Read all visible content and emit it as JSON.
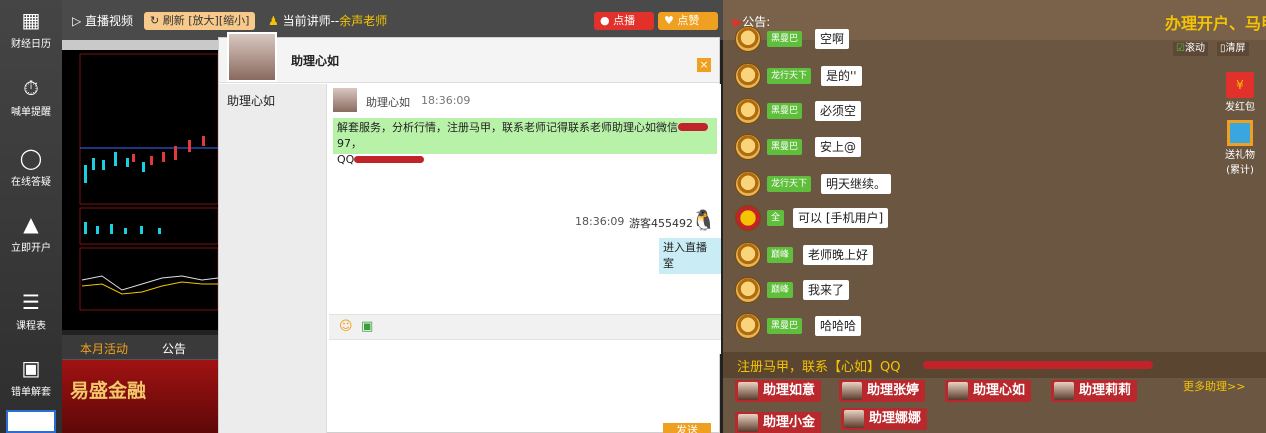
{
  "left_nav": [
    {
      "label": "财经日历",
      "icon": "calendar-icon"
    },
    {
      "label": "喊单提醒",
      "icon": "alarm-money-icon"
    },
    {
      "label": "在线答疑",
      "icon": "globe-chat-icon"
    },
    {
      "label": "立即开户",
      "icon": "graduation-cap-icon"
    },
    {
      "label": "课程表",
      "icon": "menu-list-icon"
    },
    {
      "label": "错单解套",
      "icon": "qr-code-icon"
    }
  ],
  "topbar": {
    "live_label": "直播视频",
    "refresh_label": "刷新",
    "zoom_in_label": "[放大]",
    "zoom_out_label": "[缩小]",
    "teacher_prefix": "当前讲师--",
    "teacher_name": "余声老师",
    "broadcast_label": "点播",
    "like_label": "点赞"
  },
  "left_tabs": {
    "active": "本月活动",
    "other": "公告"
  },
  "banner": {
    "text": "易盛金融"
  },
  "chat_popup": {
    "title": "助理心如",
    "contact": "助理心如",
    "msg1": {
      "sender": "助理心如",
      "time": "18:36:09",
      "text": "解套服务，分析行情，注册马甲，联系老师记得联系老师助理心如微信",
      "suffix": "97，",
      "qq": "QQ"
    },
    "msg2": {
      "time": "18:36:09",
      "sender": "游客455492",
      "text": "进入直播室"
    },
    "send_label": "发送"
  },
  "right_panel": {
    "notice_label": "公告:",
    "marquee": "办理开户、马甲",
    "scroll_label": "滚动",
    "clear_label": "清屏",
    "red_packet_label": "发红包",
    "gift_label": "送礼物",
    "gift_sub": "(累计)",
    "messages": [
      {
        "role": "黑曼巴",
        "text": "空啊"
      },
      {
        "role": "龙行天下",
        "text": "是的''"
      },
      {
        "role": "黑曼巴",
        "text": "必须空"
      },
      {
        "role": "黑曼巴",
        "text": "安上@"
      },
      {
        "role": "龙行天下",
        "text": "明天继续。"
      },
      {
        "role": "全",
        "text": "可以 [手机用户]"
      },
      {
        "role": "巅峰",
        "text": "老师晚上好"
      },
      {
        "role": "巅峰",
        "text": "我来了"
      },
      {
        "role": "黑曼巴",
        "text": "哈哈哈"
      }
    ],
    "ticker": "注册马甲，联系【心如】QQ",
    "assistants": [
      "助理如意",
      "助理张婷",
      "助理心如",
      "助理莉莉",
      "助理小金",
      "助理娜娜"
    ],
    "more_label": "更多助理>>"
  },
  "colors": {
    "orange": "#f0a020",
    "red": "#e2312a",
    "green": "#5fbf3c",
    "gold": "#f5c400"
  }
}
